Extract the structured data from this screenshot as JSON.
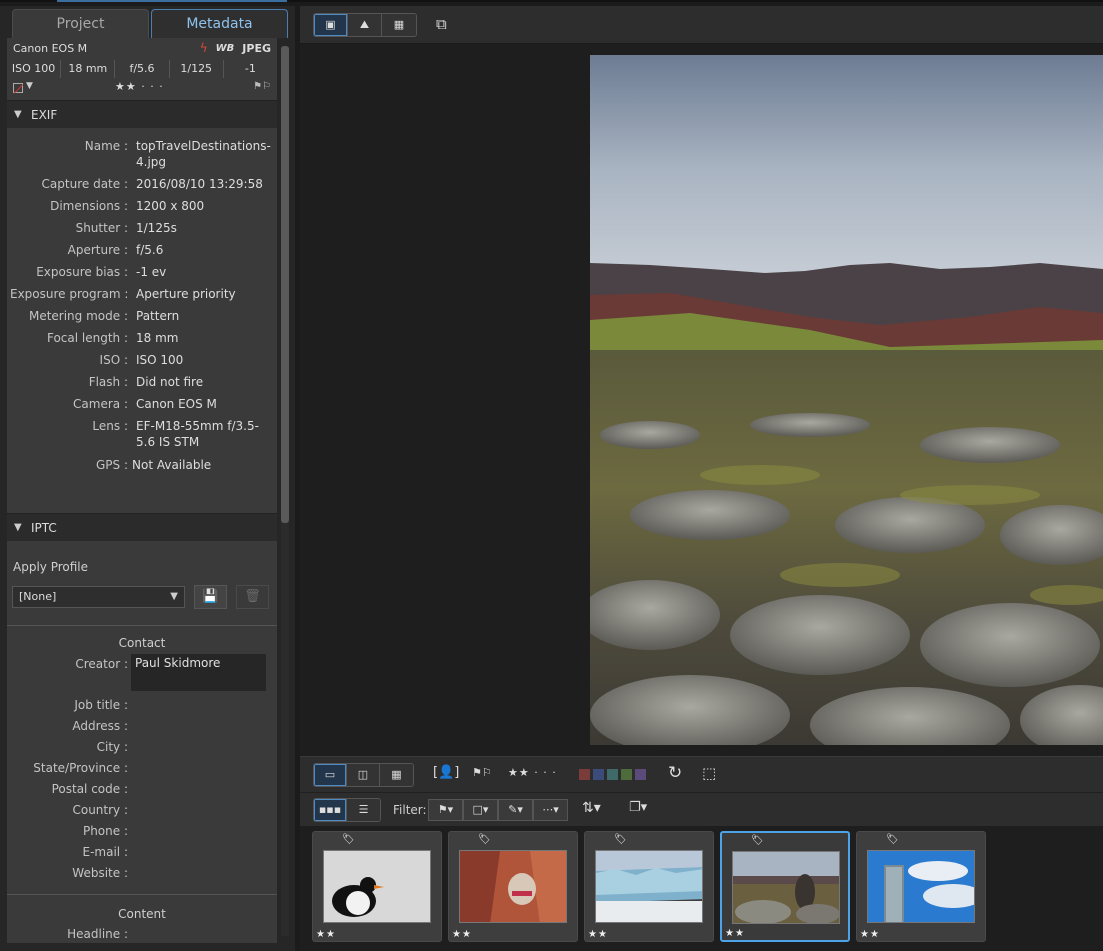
{
  "tabs": {
    "project": "Project",
    "metadata": "Metadata"
  },
  "summary": {
    "camera": "Canon EOS M",
    "wb_badge": "WB",
    "format_badge": "JPEG",
    "iso": "ISO 100",
    "focal": "18 mm",
    "aperture": "f/5.6",
    "shutter": "1/125",
    "exposure": "-1",
    "stars": "★★ · · ·",
    "color_label": "#cc3333"
  },
  "exif": {
    "title": "EXIF",
    "rows": [
      {
        "k": "Name :",
        "v": "topTravelDestinations-4.jpg"
      },
      {
        "k": "Capture date :",
        "v": "2016/08/10 13:29:58"
      },
      {
        "k": "Dimensions :",
        "v": "1200 x 800"
      },
      {
        "k": "Shutter :",
        "v": "1/125s"
      },
      {
        "k": "Aperture :",
        "v": "f/5.6"
      },
      {
        "k": "Exposure bias :",
        "v": "-1 ev"
      },
      {
        "k": "Exposure program :",
        "v": "Aperture priority"
      },
      {
        "k": "Metering mode :",
        "v": "Pattern"
      },
      {
        "k": "Focal length :",
        "v": "18 mm"
      },
      {
        "k": "ISO :",
        "v": "ISO 100"
      },
      {
        "k": "Flash :",
        "v": "Did not fire"
      },
      {
        "k": "Camera :",
        "v": "Canon EOS M"
      },
      {
        "k": "Lens :",
        "v": "EF-M18-55mm f/3.5-5.6 IS STM"
      },
      {
        "k": "GPS :",
        "v": "Not Available"
      }
    ]
  },
  "iptc": {
    "title": "IPTC",
    "apply_profile": "Apply Profile",
    "profile_value": "[None]",
    "contact_title": "Contact",
    "creator_label": "Creator :",
    "creator_value": "Paul Skidmore",
    "fields": [
      "Job title :",
      "Address :",
      "City :",
      "State/Province :",
      "Postal code :",
      "Country :",
      "Phone :",
      "E-mail :",
      "Website :"
    ],
    "content_title": "Content",
    "headline_label": "Headline :"
  },
  "toolbar2": {
    "stars": "★★ · · ·"
  },
  "toolbar3": {
    "filter_label": "Filter:"
  },
  "filmstrip": [
    {
      "name": "penguin",
      "stars": "★★",
      "selected": false
    },
    {
      "name": "canyon-camel",
      "stars": "★★",
      "selected": false
    },
    {
      "name": "glacier",
      "stars": "★★",
      "selected": false
    },
    {
      "name": "lava-field",
      "stars": "★★",
      "selected": true
    },
    {
      "name": "tower",
      "stars": "★★",
      "selected": false
    }
  ],
  "swatch_colors": [
    "#7a3b3b",
    "#3b4b7a",
    "#3f6a6a",
    "#4d6b3b",
    "#5b4b7a"
  ]
}
